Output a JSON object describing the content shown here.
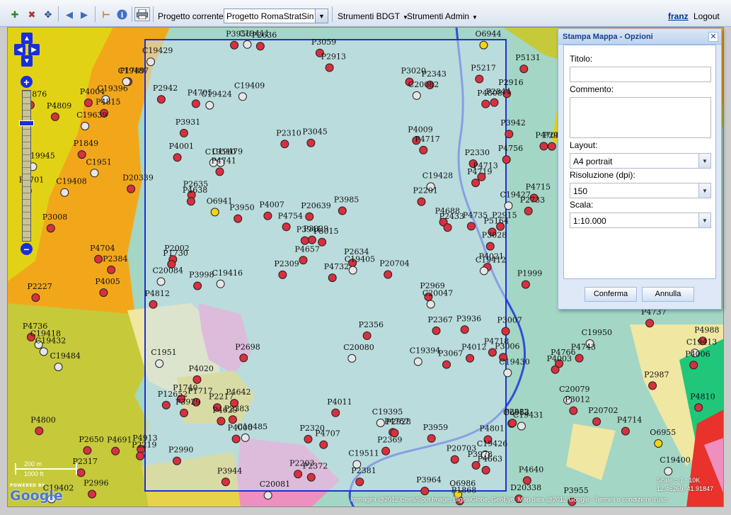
{
  "toolbar": {
    "project_label": "Progetto corrente:",
    "project_value": "Progetto RomaStratSintes",
    "menus": [
      "Strumenti BDGT",
      "Strumenti Admin"
    ],
    "user": "franz",
    "logout": "Logout",
    "icons": [
      "add-layer-icon",
      "remove-layer-icon",
      "pan-icon",
      "back-icon",
      "forward-icon",
      "measure-icon",
      "info-icon",
      "print-icon"
    ]
  },
  "map": {
    "scale_metric": "200 m",
    "scale_imperial": "1000 ft",
    "powered_by": "POWERED BY",
    "google": "Google",
    "attribution": "Immagini @2012 Cnes/Spot Image, DigitalGlobe, GeoEye, Map data @2012 Google - Termini e condizioni d'uso",
    "scale_text": "Scale = 1 : 10K",
    "coords_text": "12.46269, 41.91847",
    "colors": {
      "orange": "#f2a71b",
      "yellow": "#e2d215",
      "olive": "#c6c93a",
      "teal": "#a3d6c4",
      "pink": "#ef8fc0",
      "lightpink": "#f5c6dd",
      "green": "#20c77a",
      "red": "#e8322b",
      "print_frame": "#1f2fd8"
    },
    "labels": [
      "P4719",
      "P1868",
      "P4718",
      "P4913",
      "O6953",
      "P4715",
      "P4716",
      "P4717",
      "P12652",
      "P4714",
      "P4704",
      "P2733",
      "O6941",
      "O6955",
      "P3029",
      "P2009",
      "D20339",
      "P2309",
      "P4709",
      "P4708",
      "P4707",
      "P4706",
      "P4757",
      "P2916",
      "P2343",
      "P2915",
      "P4756",
      "P4754",
      "P2372",
      "P3059",
      "P4705",
      "O6944",
      "P4741",
      "P3045",
      "O6954",
      "P2928",
      "P3067",
      "P2227",
      "P4732",
      "P4713",
      "P2381",
      "C20084",
      "P4737",
      "P4736",
      "P4735",
      "P4743",
      "P2217",
      "O7010",
      "P4812",
      "P4801",
      "C19394",
      "P2317",
      "P1849",
      "P4011",
      "P4000",
      "P3929",
      "P3941",
      "P2701",
      "P2882",
      "P3955",
      "P3959",
      "P3956",
      "P3998",
      "P4012",
      "P4021",
      "P3978",
      "P2844",
      "P4009",
      "P3028",
      "P2698",
      "P4007",
      "P2635",
      "P4005",
      "P4006",
      "C19395",
      "P2748",
      "P2634",
      "P4691",
      "P2636",
      "P4688",
      "P4004",
      "C19396",
      "P4003",
      "C19427",
      "P2002",
      "P4687",
      "P2650",
      "C20081",
      "P4001",
      "P3964",
      "P4020",
      "P2383",
      "C19416",
      "P1999",
      "P3006",
      "C19424",
      "C19398",
      "P2384",
      "P3985",
      "P3007",
      "P2201",
      "P3015",
      "C19428",
      "C19400",
      "P2433",
      "P2220",
      "P3008",
      "P2203",
      "C19425",
      "P20639",
      "P2219",
      "P3944",
      "D20338",
      "P2985",
      "C19426",
      "P4642",
      "P2367",
      "P3020",
      "P2987",
      "C19418",
      "P4629",
      "P4640",
      "P2369",
      "P2942",
      "P2990",
      "P2345",
      "C19485",
      "P4766",
      "P3942",
      "P20702",
      "P2968",
      "P1789",
      "P4638",
      "C19405",
      "C19408",
      "P20703",
      "C19429",
      "P1717",
      "P2356",
      "C20082",
      "C19403",
      "P3936",
      "C19409",
      "P2969",
      "C19482",
      "C19402",
      "P3012",
      "P3931",
      "P4663",
      "P4657",
      "C19413",
      "C20080",
      "P20704",
      "C19430",
      "C19479",
      "P4809",
      "P4811",
      "C19411",
      "P2996",
      "P2340",
      "P4810",
      "C19431",
      "P4988",
      "P4808",
      "P3030",
      "C19412",
      "P2380",
      "C19432",
      "P4815",
      "P3966",
      "P2913",
      "C19478",
      "O6986",
      "C20079",
      "P2310",
      "P5131",
      "P4800",
      "P2320",
      "P2330",
      "C19487",
      "C20047",
      "P5217",
      "C19510",
      "C19639",
      "C1951",
      "P5146",
      "C19511",
      "C19484",
      "P5164",
      "P1876",
      "C1951",
      "C19950",
      "P1730",
      "P1740",
      "C19945",
      "P3950"
    ]
  },
  "dialog": {
    "title": "Stampa Mappa - Opzioni",
    "titolo_label": "Titolo:",
    "titolo_value": "",
    "commento_label": "Commento:",
    "commento_value": "",
    "layout_label": "Layout:",
    "layout_value": "A4 portrait",
    "risoluzione_label": "Risoluzione (dpi):",
    "risoluzione_value": "150",
    "scala_label": "Scala:",
    "scala_value": "1:10.000",
    "confirm": "Conferma",
    "cancel": "Annulla"
  }
}
